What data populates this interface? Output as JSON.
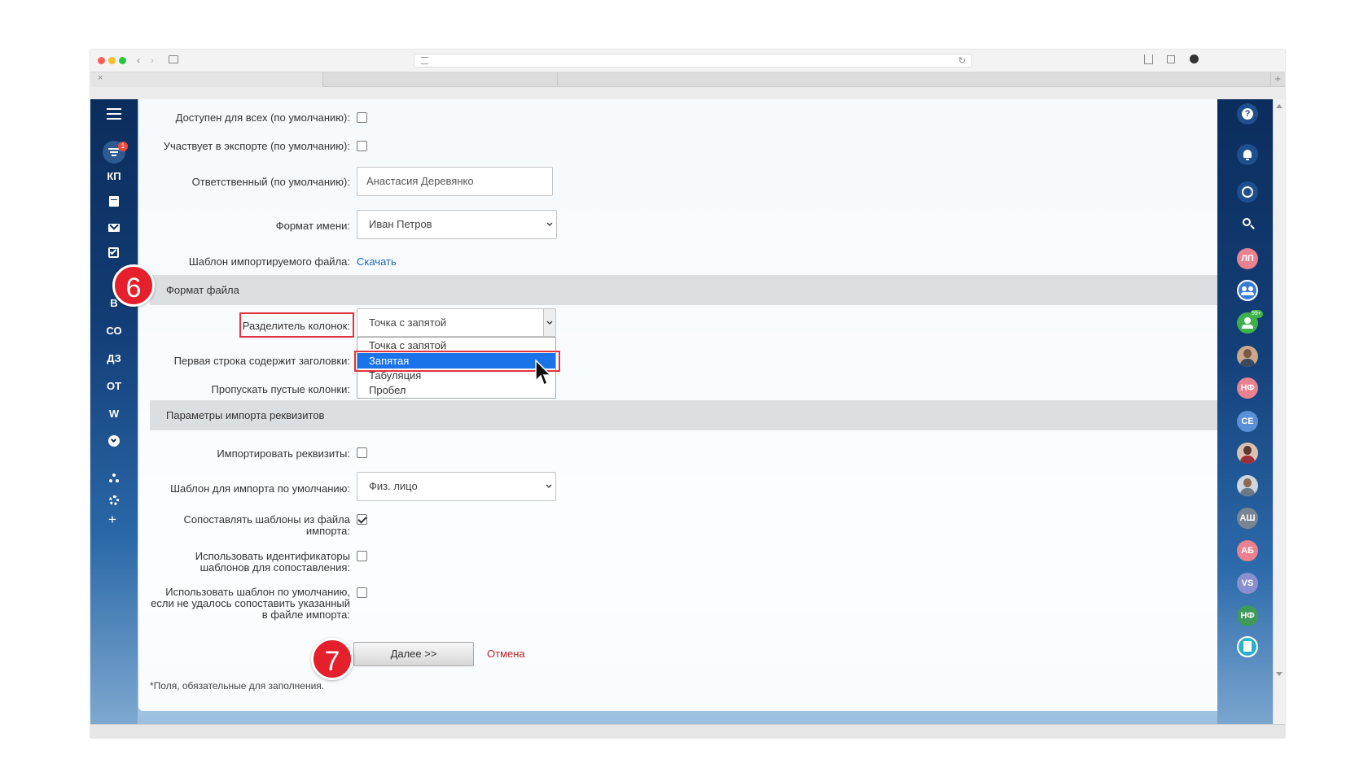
{
  "form": {
    "available_all": "Доступен для всех (по умолчанию):",
    "export": "Участвует в экспорте (по умолчанию):",
    "responsible_label": "Ответственный (по умолчанию):",
    "responsible_value": "Анастасия Деревянко",
    "name_format_label": "Формат имени:",
    "name_format_value": "Иван Петров",
    "template_label": "Шаблон импортируемого файла:",
    "template_link": "Скачать",
    "section_file_format": "Формат файла",
    "col_sep_label": "Разделитель колонок:",
    "col_sep_value": "Точка с запятой",
    "first_row_label": "Первая строка содержит заголовки:",
    "skip_empty_label": "Пропускать пустые колонки:",
    "section_requisites": "Параметры импорта реквизитов",
    "import_req_label": "Импортировать реквизиты:",
    "default_template_label": "Шаблон для импорта по умолчанию:",
    "default_template_value": "Физ. лицо",
    "match_templates_label_1": "Сопоставлять шаблоны из файла",
    "match_templates_label_2": "импорта:",
    "use_ids_label_1": "Использовать идентификаторы",
    "use_ids_label_2": "шаблонов для сопоставления:",
    "use_default_label_1": "Использовать шаблон по умолчанию,",
    "use_default_label_2": "если не удалось сопоставить указанный",
    "use_default_label_3": "в файле импорта:",
    "next_button": "Далее >>",
    "cancel_link": "Отмена",
    "required_note": "*Поля, обязательные для заполнения.",
    "checks": {
      "available_all": false,
      "export": false,
      "import_req": false,
      "match_templates": true,
      "use_ids": false,
      "use_default": false
    }
  },
  "dropdown": {
    "options": [
      "Точка с запятой",
      "Запятая",
      "Табуляция",
      "Пробел"
    ],
    "highlighted": "Запятая"
  },
  "markers": {
    "m6": "6",
    "m7": "7"
  },
  "left_sidebar": {
    "badge": "1",
    "items": [
      "КП",
      "В",
      "СО",
      "ДЗ",
      "ОТ",
      "W"
    ]
  },
  "right_sidebar": {
    "badge": "99+",
    "initials": [
      "ЛП",
      "НФ",
      "СЕ",
      "АШ",
      "АБ",
      "VS",
      "НФ"
    ]
  },
  "colors": {
    "accent": "#1a73e8",
    "marker": "#e51f2b",
    "highlight_box": "#e0343f",
    "sidebar": "#0b2d5c",
    "link": "#2067b0",
    "cancel": "#b0262a"
  }
}
